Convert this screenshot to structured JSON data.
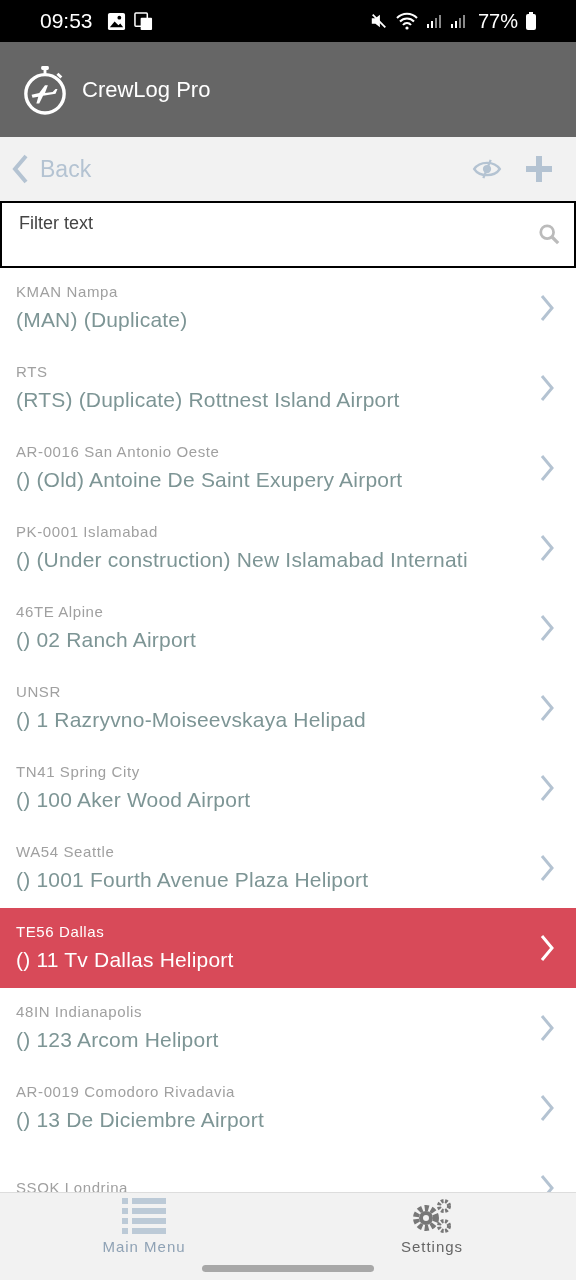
{
  "status_bar": {
    "time": "09:53",
    "battery": "77%"
  },
  "header": {
    "title": "CrewLog Pro"
  },
  "toolbar": {
    "back": "Back"
  },
  "filter": {
    "placeholder": "Filter text"
  },
  "airports": [
    {
      "code": "KMAN Nampa",
      "name": "(MAN) (Duplicate)",
      "selected": false
    },
    {
      "code": "RTS",
      "name": "(RTS) (Duplicate) Rottnest Island Airport",
      "selected": false
    },
    {
      "code": "AR-0016 San Antonio Oeste",
      "name": "() (Old) Antoine De Saint Exupery Airport",
      "selected": false
    },
    {
      "code": "PK-0001 Islamabad",
      "name": "() (Under construction) New Islamabad Internati",
      "selected": false
    },
    {
      "code": "46TE Alpine",
      "name": "() 02 Ranch Airport",
      "selected": false
    },
    {
      "code": "UNSR",
      "name": "() 1 Razryvno-Moiseevskaya Helipad",
      "selected": false
    },
    {
      "code": "TN41 Spring City",
      "name": "() 100 Aker Wood Airport",
      "selected": false
    },
    {
      "code": "WA54 Seattle",
      "name": "() 1001 Fourth Avenue Plaza Heliport",
      "selected": false
    },
    {
      "code": "TE56 Dallas",
      "name": "() 11 Tv Dallas Heliport",
      "selected": true
    },
    {
      "code": "48IN Indianapolis",
      "name": "() 123 Arcom Heliport",
      "selected": false
    },
    {
      "code": "AR-0019 Comodoro Rivadavia",
      "name": "() 13 De Diciembre Airport",
      "selected": false
    },
    {
      "code": "SSOK Londrina",
      "selected": false
    }
  ],
  "bottom_nav": [
    {
      "label": "Main Menu",
      "kind": "list",
      "disabled": true
    },
    {
      "label": "Settings",
      "kind": "gears",
      "disabled": false
    }
  ]
}
